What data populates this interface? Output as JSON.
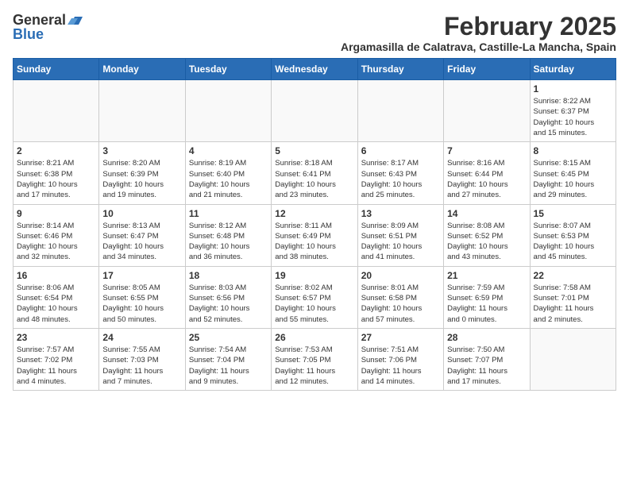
{
  "logo": {
    "general": "General",
    "blue": "Blue"
  },
  "header": {
    "title": "February 2025",
    "subtitle": "Argamasilla de Calatrava, Castille-La Mancha, Spain"
  },
  "weekdays": [
    "Sunday",
    "Monday",
    "Tuesday",
    "Wednesday",
    "Thursday",
    "Friday",
    "Saturday"
  ],
  "weeks": [
    [
      {
        "day": "",
        "info": ""
      },
      {
        "day": "",
        "info": ""
      },
      {
        "day": "",
        "info": ""
      },
      {
        "day": "",
        "info": ""
      },
      {
        "day": "",
        "info": ""
      },
      {
        "day": "",
        "info": ""
      },
      {
        "day": "1",
        "info": "Sunrise: 8:22 AM\nSunset: 6:37 PM\nDaylight: 10 hours\nand 15 minutes."
      }
    ],
    [
      {
        "day": "2",
        "info": "Sunrise: 8:21 AM\nSunset: 6:38 PM\nDaylight: 10 hours\nand 17 minutes."
      },
      {
        "day": "3",
        "info": "Sunrise: 8:20 AM\nSunset: 6:39 PM\nDaylight: 10 hours\nand 19 minutes."
      },
      {
        "day": "4",
        "info": "Sunrise: 8:19 AM\nSunset: 6:40 PM\nDaylight: 10 hours\nand 21 minutes."
      },
      {
        "day": "5",
        "info": "Sunrise: 8:18 AM\nSunset: 6:41 PM\nDaylight: 10 hours\nand 23 minutes."
      },
      {
        "day": "6",
        "info": "Sunrise: 8:17 AM\nSunset: 6:43 PM\nDaylight: 10 hours\nand 25 minutes."
      },
      {
        "day": "7",
        "info": "Sunrise: 8:16 AM\nSunset: 6:44 PM\nDaylight: 10 hours\nand 27 minutes."
      },
      {
        "day": "8",
        "info": "Sunrise: 8:15 AM\nSunset: 6:45 PM\nDaylight: 10 hours\nand 29 minutes."
      }
    ],
    [
      {
        "day": "9",
        "info": "Sunrise: 8:14 AM\nSunset: 6:46 PM\nDaylight: 10 hours\nand 32 minutes."
      },
      {
        "day": "10",
        "info": "Sunrise: 8:13 AM\nSunset: 6:47 PM\nDaylight: 10 hours\nand 34 minutes."
      },
      {
        "day": "11",
        "info": "Sunrise: 8:12 AM\nSunset: 6:48 PM\nDaylight: 10 hours\nand 36 minutes."
      },
      {
        "day": "12",
        "info": "Sunrise: 8:11 AM\nSunset: 6:49 PM\nDaylight: 10 hours\nand 38 minutes."
      },
      {
        "day": "13",
        "info": "Sunrise: 8:09 AM\nSunset: 6:51 PM\nDaylight: 10 hours\nand 41 minutes."
      },
      {
        "day": "14",
        "info": "Sunrise: 8:08 AM\nSunset: 6:52 PM\nDaylight: 10 hours\nand 43 minutes."
      },
      {
        "day": "15",
        "info": "Sunrise: 8:07 AM\nSunset: 6:53 PM\nDaylight: 10 hours\nand 45 minutes."
      }
    ],
    [
      {
        "day": "16",
        "info": "Sunrise: 8:06 AM\nSunset: 6:54 PM\nDaylight: 10 hours\nand 48 minutes."
      },
      {
        "day": "17",
        "info": "Sunrise: 8:05 AM\nSunset: 6:55 PM\nDaylight: 10 hours\nand 50 minutes."
      },
      {
        "day": "18",
        "info": "Sunrise: 8:03 AM\nSunset: 6:56 PM\nDaylight: 10 hours\nand 52 minutes."
      },
      {
        "day": "19",
        "info": "Sunrise: 8:02 AM\nSunset: 6:57 PM\nDaylight: 10 hours\nand 55 minutes."
      },
      {
        "day": "20",
        "info": "Sunrise: 8:01 AM\nSunset: 6:58 PM\nDaylight: 10 hours\nand 57 minutes."
      },
      {
        "day": "21",
        "info": "Sunrise: 7:59 AM\nSunset: 6:59 PM\nDaylight: 11 hours\nand 0 minutes."
      },
      {
        "day": "22",
        "info": "Sunrise: 7:58 AM\nSunset: 7:01 PM\nDaylight: 11 hours\nand 2 minutes."
      }
    ],
    [
      {
        "day": "23",
        "info": "Sunrise: 7:57 AM\nSunset: 7:02 PM\nDaylight: 11 hours\nand 4 minutes."
      },
      {
        "day": "24",
        "info": "Sunrise: 7:55 AM\nSunset: 7:03 PM\nDaylight: 11 hours\nand 7 minutes."
      },
      {
        "day": "25",
        "info": "Sunrise: 7:54 AM\nSunset: 7:04 PM\nDaylight: 11 hours\nand 9 minutes."
      },
      {
        "day": "26",
        "info": "Sunrise: 7:53 AM\nSunset: 7:05 PM\nDaylight: 11 hours\nand 12 minutes."
      },
      {
        "day": "27",
        "info": "Sunrise: 7:51 AM\nSunset: 7:06 PM\nDaylight: 11 hours\nand 14 minutes."
      },
      {
        "day": "28",
        "info": "Sunrise: 7:50 AM\nSunset: 7:07 PM\nDaylight: 11 hours\nand 17 minutes."
      },
      {
        "day": "",
        "info": ""
      }
    ]
  ]
}
